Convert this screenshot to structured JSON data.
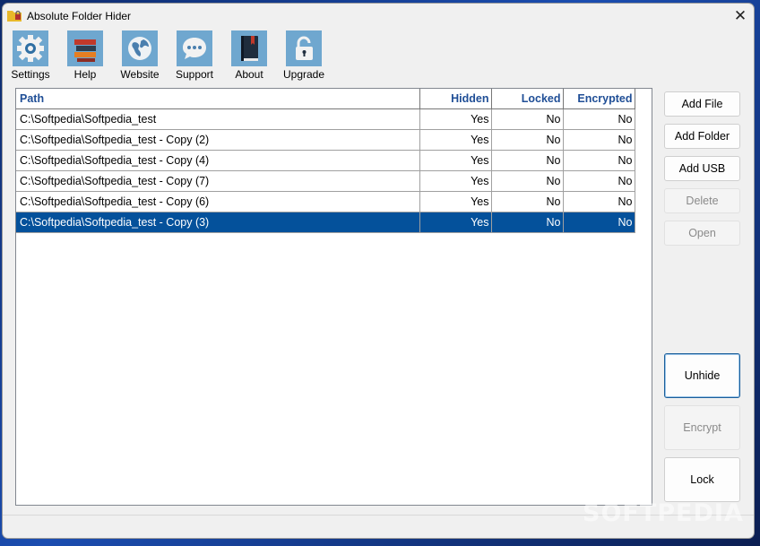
{
  "window": {
    "title": "Absolute Folder Hider"
  },
  "toolbar": [
    {
      "label": "Settings",
      "icon": "gear-icon"
    },
    {
      "label": "Help",
      "icon": "books-icon"
    },
    {
      "label": "Website",
      "icon": "globe-icon"
    },
    {
      "label": "Support",
      "icon": "chat-bubble-icon"
    },
    {
      "label": "About",
      "icon": "book-icon"
    },
    {
      "label": "Upgrade",
      "icon": "unlocked-padlock-icon"
    }
  ],
  "table": {
    "columns": [
      "Path",
      "Hidden",
      "Locked",
      "Encrypted"
    ],
    "rows": [
      {
        "path": "C:\\Softpedia\\Softpedia_test",
        "hidden": "Yes",
        "locked": "No",
        "encrypted": "No"
      },
      {
        "path": "C:\\Softpedia\\Softpedia_test - Copy (2)",
        "hidden": "Yes",
        "locked": "No",
        "encrypted": "No"
      },
      {
        "path": "C:\\Softpedia\\Softpedia_test - Copy (4)",
        "hidden": "Yes",
        "locked": "No",
        "encrypted": "No"
      },
      {
        "path": "C:\\Softpedia\\Softpedia_test - Copy (7)",
        "hidden": "Yes",
        "locked": "No",
        "encrypted": "No"
      },
      {
        "path": "C:\\Softpedia\\Softpedia_test - Copy (6)",
        "hidden": "Yes",
        "locked": "No",
        "encrypted": "No"
      },
      {
        "path": "C:\\Softpedia\\Softpedia_test - Copy (3)",
        "hidden": "Yes",
        "locked": "No",
        "encrypted": "No"
      }
    ],
    "selected_row": 5
  },
  "buttons": {
    "add_file": "Add File",
    "add_folder": "Add Folder",
    "add_usb": "Add USB",
    "delete": "Delete",
    "open": "Open",
    "unhide": "Unhide",
    "encrypt": "Encrypt",
    "lock": "Lock"
  },
  "watermark": "SOFTPEDIA",
  "colors": {
    "toolbar_icon_bg": "#6fa7cf",
    "selection": "#04519b",
    "header_text": "#1f4e96"
  }
}
